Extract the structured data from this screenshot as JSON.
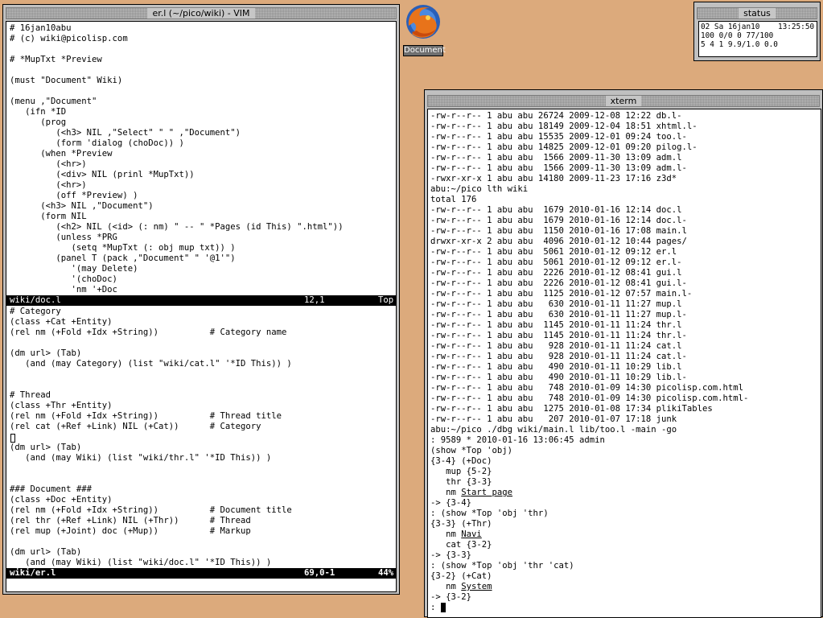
{
  "vim": {
    "title": "er.l (~/pico/wiki) - VIM",
    "top_lines": [
      "# 16jan10abu",
      "# (c) wiki@picolisp.com",
      "",
      "# *MupTxt *Preview",
      "",
      "(must \"Document\" Wiki)",
      "",
      "(menu ,\"Document\"",
      "   (ifn *ID",
      "      (prog",
      "         (<h3> NIL ,\"Select\" \" \" ,\"Document\")",
      "         (form 'dialog (choDoc)) )",
      "      (when *Preview",
      "         (<hr>)",
      "         (<div> NIL (prinl *MupTxt))",
      "         (<hr>)",
      "         (off *Preview) )",
      "      (<h3> NIL ,\"Document\")",
      "      (form NIL",
      "         (<h2> NIL (<id> (: nm) \" -- \" *Pages (id This) \".html\"))",
      "         (unless *PRG",
      "            (setq *MupTxt (: obj mup txt)) )",
      "         (panel T (pack ,\"Document\" \" '@1'\")",
      "            '(may Delete)",
      "            '(choDoc)",
      "            'nm '+Doc"
    ],
    "top_status": {
      "file": "wiki/doc.l",
      "pos": "12,1",
      "scroll": "Top"
    },
    "bottom_lines_a": [
      "# Category",
      "(class +Cat +Entity)",
      "(rel nm (+Fold +Idx +String))          # Category name",
      "",
      "(dm url> (Tab)",
      "   (and (may Category) (list \"wiki/cat.l\" '*ID This)) )",
      "",
      "",
      "# Thread",
      "(class +Thr +Entity)",
      "(rel nm (+Fold +Idx +String))          # Thread title",
      "(rel cat (+Ref +Link) NIL (+Cat))      # Category"
    ],
    "bottom_lines_b": [
      "(dm url> (Tab)",
      "   (and (may Wiki) (list \"wiki/thr.l\" '*ID This)) )",
      "",
      "",
      "### Document ###",
      "(class +Doc +Entity)",
      "(rel nm (+Fold +Idx +String))          # Document title",
      "(rel thr (+Ref +Link) NIL (+Thr))      # Thread",
      "(rel mup (+Joint) doc (+Mup))          # Markup",
      "",
      "(dm url> (Tab)",
      "   (and (may Wiki) (list \"wiki/doc.l\" '*ID This)) )"
    ],
    "bottom_status": {
      "file": "wiki/er.l",
      "pos": "69,0-1",
      "scroll": "44%"
    }
  },
  "desktop_icon": {
    "label": "Document",
    "icon": "firefox-icon"
  },
  "status_win": {
    "title": "status",
    "line1": "02 Sa 16jan10    13:25:50",
    "line2": "100 0/0 0 77/100",
    "line3": "5 4 1 9.9/1.0 0.0"
  },
  "xterm": {
    "title": "xterm",
    "listing1": [
      "-rw-r--r-- 1 abu abu 26724 2009-12-08 12:22 db.l-",
      "-rw-r--r-- 1 abu abu 18149 2009-12-04 18:51 xhtml.l-",
      "-rw-r--r-- 1 abu abu 15535 2009-12-01 09:24 too.l-",
      "-rw-r--r-- 1 abu abu 14825 2009-12-01 09:20 pilog.l-",
      "-rw-r--r-- 1 abu abu  1566 2009-11-30 13:09 adm.l",
      "-rw-r--r-- 1 abu abu  1566 2009-11-30 13:09 adm.l-",
      "-rwxr-xr-x 1 abu abu 14180 2009-11-23 17:16 z3d*",
      "abu:~/pico lth wiki",
      "total 176",
      "-rw-r--r-- 1 abu abu  1679 2010-01-16 12:14 doc.l",
      "-rw-r--r-- 1 abu abu  1679 2010-01-16 12:14 doc.l-",
      "-rw-r--r-- 1 abu abu  1150 2010-01-16 17:08 main.l",
      "drwxr-xr-x 2 abu abu  4096 2010-01-12 10:44 pages/",
      "-rw-r--r-- 1 abu abu  5061 2010-01-12 09:12 er.l",
      "-rw-r--r-- 1 abu abu  5061 2010-01-12 09:12 er.l-",
      "-rw-r--r-- 1 abu abu  2226 2010-01-12 08:41 gui.l",
      "-rw-r--r-- 1 abu abu  2226 2010-01-12 08:41 gui.l-",
      "-rw-r--r-- 1 abu abu  1125 2010-01-12 07:57 main.l-",
      "-rw-r--r-- 1 abu abu   630 2010-01-11 11:27 mup.l",
      "-rw-r--r-- 1 abu abu   630 2010-01-11 11:27 mup.l-",
      "-rw-r--r-- 1 abu abu  1145 2010-01-11 11:24 thr.l",
      "-rw-r--r-- 1 abu abu  1145 2010-01-11 11:24 thr.l-",
      "-rw-r--r-- 1 abu abu   928 2010-01-11 11:24 cat.l",
      "-rw-r--r-- 1 abu abu   928 2010-01-11 11:24 cat.l-",
      "-rw-r--r-- 1 abu abu   490 2010-01-11 10:29 lib.l",
      "-rw-r--r-- 1 abu abu   490 2010-01-11 10:29 lib.l-",
      "-rw-r--r-- 1 abu abu   748 2010-01-09 14:30 picolisp.com.html",
      "-rw-r--r-- 1 abu abu   748 2010-01-09 14:30 picolisp.com.html-",
      "-rw-r--r-- 1 abu abu  1275 2010-01-08 17:34 plikiTables",
      "-rw-r--r-- 1 abu abu   207 2010-01-07 17:18 junk",
      "abu:~/pico ./dbg wiki/main.l lib/too.l -main -go",
      ": 9589 * 2010-01-16 13:06:45 admin",
      "(show *Top 'obj)",
      "{3-4} (+Doc)"
    ],
    "listing2": [
      "   mup {5-2}",
      "   thr {3-3}"
    ],
    "nm1_prefix": "   nm ",
    "nm1_value": "Start page",
    "listing3": [
      "-> {3-4}",
      ": (show *Top 'obj 'thr)",
      "{3-3} (+Thr)"
    ],
    "nm2_prefix": "   nm ",
    "nm2_value": "Navi",
    "listing4": [
      "   cat {3-2}",
      "-> {3-3}",
      ": (show *Top 'obj 'thr 'cat)",
      "{3-2} (+Cat)"
    ],
    "nm3_prefix": "   nm ",
    "nm3_value": "System",
    "listing5": [
      "-> {3-2}"
    ],
    "prompt": ": "
  }
}
